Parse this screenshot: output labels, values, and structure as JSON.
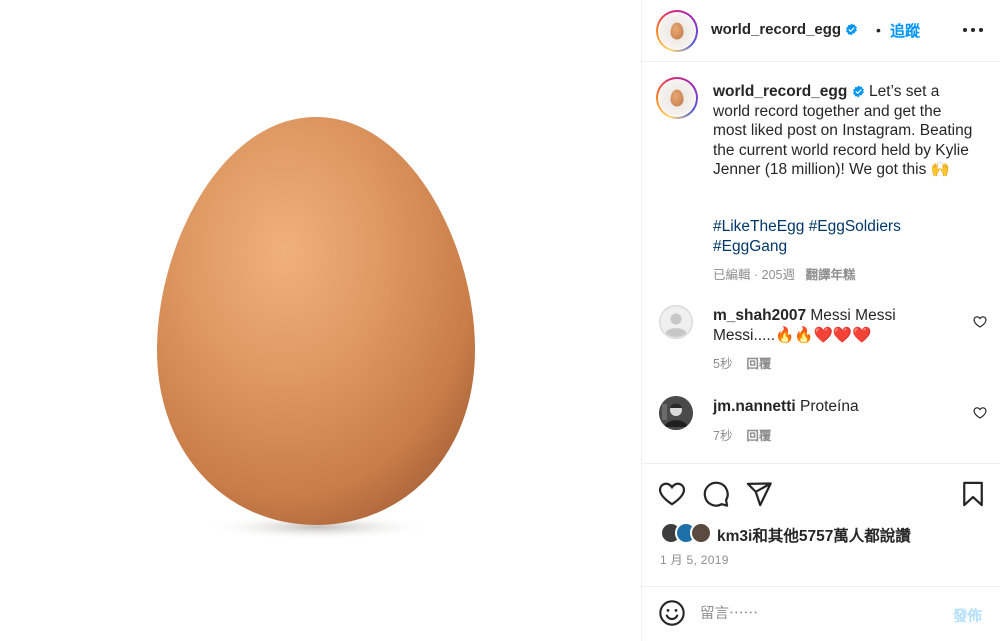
{
  "post": {
    "image_alt": "egg",
    "author": {
      "username": "world_record_egg",
      "verified": true
    },
    "header": {
      "dot": "•",
      "follow_label": "追蹤",
      "more_icon": "more-horizontal-icon"
    },
    "caption": {
      "username": "world_record_egg",
      "text": "Let’s set a world record together and get the most liked post on Instagram. Beating the current world record held by Kylie Jenner (18 million)! We got this 🙌",
      "hashtags": "#LikeTheEgg #EggSoldiers #EggGang",
      "meta_edited": "已編輯",
      "meta_sep": "·",
      "meta_time": "205週",
      "meta_translate": "翻譯年糕"
    },
    "comments": [
      {
        "username": "m_shah2007",
        "text": "Messi Messi Messi.....🔥🔥❤️❤️❤️",
        "time": "5秒",
        "reply_label": "回覆"
      },
      {
        "username": "jm.nannetti",
        "text": "Proteína",
        "time": "7秒",
        "reply_label": "回覆"
      }
    ],
    "likes_text": "km3i和其他5757萬人都說讚",
    "date": "1 月 5, 2019",
    "add_comment": {
      "placeholder": "留言⋯⋯",
      "post_label": "發佈"
    }
  },
  "colors": {
    "accent": "#0095f6",
    "hashtag": "#00376b",
    "muted": "#8e8e8e",
    "post_disabled": "#b2dffc",
    "egg": "#d98f5b",
    "heart_red": "#ed4956"
  }
}
